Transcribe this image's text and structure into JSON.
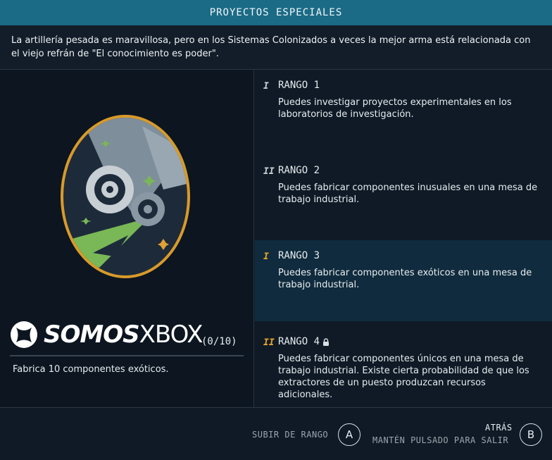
{
  "header": {
    "title": "PROYECTOS ESPECIALES"
  },
  "intro": {
    "text": "La artillería pesada es maravillosa, pero en los Sistemas Colonizados a veces la mejor arma está relacionada con el viejo refrán de \"El conocimiento es poder\"."
  },
  "skill": {
    "badge_icon": "gears-and-tools-patch-icon",
    "progress": "(0/10)",
    "objective": "Fabrica 10 componentes exóticos.",
    "watermark": {
      "part1": "SOMOS",
      "part2": "XBOX"
    }
  },
  "ranks": [
    {
      "marker": "I",
      "title": "RANGO 1",
      "description": "Puedes investigar proyectos experimentales en los laboratorios de investigación.",
      "marker_color": "#c8ced2",
      "active": false,
      "locked": false
    },
    {
      "marker": "II",
      "title": "RANGO 2",
      "description": "Puedes fabricar componentes inusuales en una mesa de trabajo industrial.",
      "marker_color": "#c8ced2",
      "active": false,
      "locked": false
    },
    {
      "marker": "I",
      "title": "RANGO 3",
      "description": "Puedes fabricar componentes exóticos en una mesa de trabajo industrial.",
      "marker_color": "#e8a627",
      "active": true,
      "locked": false
    },
    {
      "marker": "II",
      "title": "RANGO 4",
      "description": "Puedes fabricar componentes únicos en una mesa de trabajo industrial. Existe cierta probabilidad de que los extractores de un puesto produzcan recursos adicionales.",
      "marker_color": "#e8a627",
      "active": false,
      "locked": true
    }
  ],
  "footer": {
    "rank_up_label": "SUBIR DE RANGO",
    "rank_up_button": "A",
    "back_label": "ATRÁS",
    "back_hint": "MANTÉN PULSADO PARA SALIR",
    "back_button": "B"
  },
  "colors": {
    "header_bg": "#1b6b86",
    "active_row": "#102b3d",
    "accent": "#e8a627"
  }
}
